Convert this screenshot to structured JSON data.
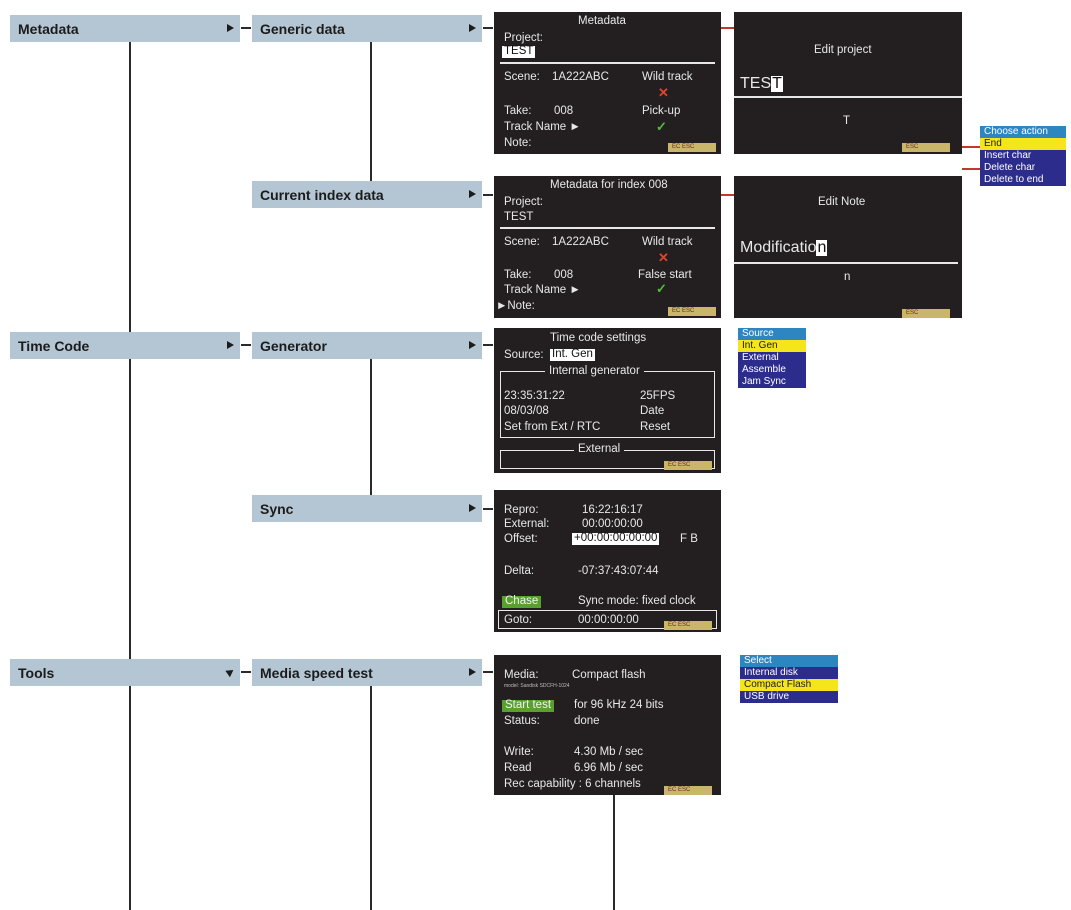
{
  "menus": {
    "metadata": "Metadata",
    "time_code": "Time Code",
    "tools": "Tools",
    "generic_data": "Generic data",
    "current_index_data": "Current index data",
    "generator": "Generator",
    "sync": "Sync",
    "media_speed_test": "Media speed test"
  },
  "metadata_screen": {
    "title": "Metadata",
    "project_label": "Project:",
    "project_value": "TEST",
    "scene_label": "Scene:",
    "scene_value": "1A222ABC",
    "wild_track": "Wild track",
    "take_label": "Take:",
    "take_value": "008",
    "pickup": "Pick-up",
    "track_name": "Track Name ►",
    "note": "Note:",
    "esc": "EC ESC"
  },
  "edit_project": {
    "title": "Edit project",
    "value_prefix": "TES",
    "cursor_char": "T",
    "preview_char": "T",
    "esc": "ESC"
  },
  "action_popup": {
    "items": [
      "Choose action",
      "End",
      "Insert char",
      "Delete char",
      "Delete to end"
    ]
  },
  "index_screen": {
    "title": "Metadata for index 008",
    "project_label": "Project:",
    "project_value": "TEST",
    "scene_label": "Scene:",
    "scene_value": "1A222ABC",
    "wild_track": "Wild track",
    "take_label": "Take:",
    "take_value": "008",
    "false_start": "False start",
    "track_name": "Track Name ►",
    "note": "►Note:",
    "esc": "EC ESC"
  },
  "edit_note": {
    "title": "Edit Note",
    "value_prefix": "Modificatio",
    "cursor_char": "n",
    "preview_char": "n",
    "esc": "ESC"
  },
  "timecode_screen": {
    "title": "Time code settings",
    "source_label": "Source:",
    "source_value": "Int. Gen",
    "internal_generator": "Internal generator",
    "time": "23:35:31:22",
    "fps": "25FPS",
    "date_value": "08/03/08",
    "date_label": "Date",
    "set_from": "Set from Ext / RTC",
    "reset": "Reset",
    "external": "External",
    "esc": "EC ESC"
  },
  "source_popup": {
    "items": [
      "Source",
      "Int. Gen",
      "External",
      "Assemble",
      "Jam Sync"
    ]
  },
  "sync_screen": {
    "repro_label": "Repro:",
    "repro_value": "16:22:16:17",
    "external_label": "External:",
    "external_value": "00:00:00:00",
    "offset_label": "Offset:",
    "offset_value": "+00:00:00:00:00",
    "offset_flags": "F B",
    "delta_label": "Delta:",
    "delta_value": "-07:37:43:07:44",
    "chase": "Chase",
    "sync_mode": "Sync mode: fixed clock",
    "goto_label": "Goto:",
    "goto_value": "00:00:00:00",
    "esc": "EC ESC"
  },
  "media_screen": {
    "media_label": "Media:",
    "media_value": "Compact flash",
    "model": "model: Sandisk SDCFH-1024",
    "start_test": "Start test",
    "test_format": "for 96 kHz 24 bits",
    "status_label": "Status:",
    "status_value": "done",
    "write_label": "Write:",
    "write_value": "4.30 Mb / sec",
    "read_label": "Read",
    "read_value": "6.96 Mb / sec",
    "rec_capability": "Rec capability : 6 channels",
    "esc": "EC ESC"
  },
  "media_popup": {
    "items": [
      "Select",
      "Internal disk",
      "Compact Flash",
      "USB drive"
    ]
  },
  "colors": {
    "menu_bg": "#b4c6d3",
    "screen_bg": "#231f20",
    "popup_head": "#2e86c1",
    "popup_selected": "#f4e61a",
    "popup_normal": "#2c2c8c",
    "connector_red": "#c0392b"
  }
}
